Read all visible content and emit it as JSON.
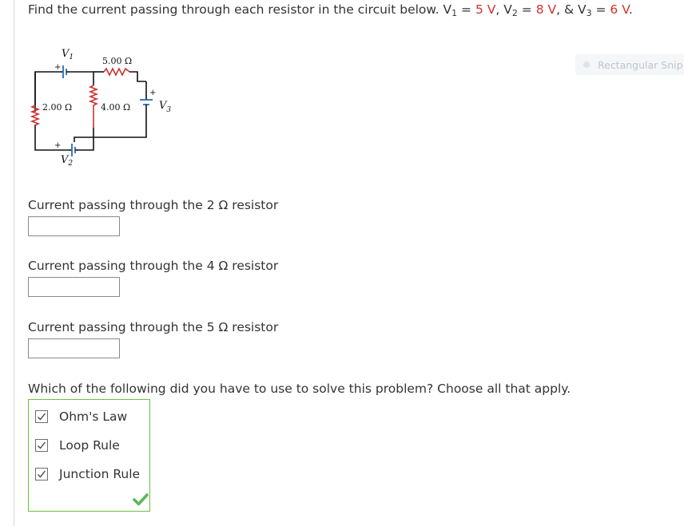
{
  "question": {
    "prefix": "Find the current passing through each resistor in the circuit below. V",
    "v1_sub": "1",
    "eq1": " = ",
    "v1_value": "5 V",
    "sep1": ", V",
    "v2_sub": "2",
    "eq2": " = ",
    "v2_value": "8 V",
    "sep2": ", & V",
    "v3_sub": "3",
    "eq3": " = ",
    "v3_value": "6 V",
    "suffix": "."
  },
  "snippet": {
    "label": "Rectangular Snip"
  },
  "circuit": {
    "r5_label": "5.00 Ω",
    "r2_label": "2.00 Ω",
    "r4_label": "4.00 Ω",
    "v1_letter": "V",
    "v1_sub": "1",
    "v2_letter": "V",
    "v2_sub": "2",
    "v3_letter": "V",
    "v3_sub": "3",
    "plus": "+"
  },
  "parts": [
    {
      "label": "Current passing through the 2 Ω resistor",
      "value": ""
    },
    {
      "label": "Current passing through the 4 Ω resistor",
      "value": ""
    },
    {
      "label": "Current passing through the 5 Ω resistor",
      "value": ""
    }
  ],
  "multi": {
    "prompt": "Which of the following did you have to use to solve this problem? Choose all that apply.",
    "options": [
      {
        "label": "Ohm's Law",
        "checked": true
      },
      {
        "label": "Loop Rule",
        "checked": true
      },
      {
        "label": "Junction Rule",
        "checked": true
      }
    ],
    "status": "correct"
  },
  "colors": {
    "given_value": "#d0312d",
    "resistor": "#d0312d",
    "battery": "#2b6cb0",
    "correct_border": "#6fbf40",
    "checkmark": "#5cb85c"
  },
  "icons": {
    "checkbox_checked": "checkbox-checked-icon",
    "correct": "green-check-icon"
  }
}
